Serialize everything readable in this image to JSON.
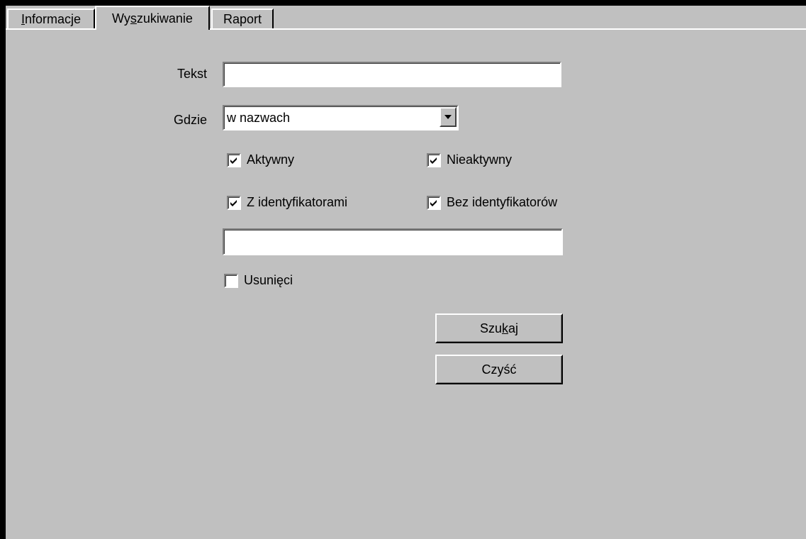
{
  "tabs": [
    {
      "label_pre": "",
      "label_u": "I",
      "label_post": "nformacje",
      "active": false
    },
    {
      "label_pre": "Wy",
      "label_u": "s",
      "label_post": "zukiwanie",
      "active": true
    },
    {
      "label_pre": "Raport",
      "label_u": "",
      "label_post": "",
      "active": false
    }
  ],
  "form": {
    "text_label": "Tekst",
    "text_value": "",
    "where_label": "Gdzie",
    "where_selected": "w nazwach",
    "active_label": "Aktywny",
    "active_checked": true,
    "inactive_label": "Nieaktywny",
    "inactive_checked": true,
    "with_ids_label": "Z identyfikatorami",
    "with_ids_checked": true,
    "without_ids_label": "Bez identyfikatorów",
    "without_ids_checked": true,
    "second_field_value": "",
    "deleted_label": "Usunięci",
    "deleted_checked": false
  },
  "buttons": {
    "search_pre": "Szu",
    "search_u": "k",
    "search_post": "aj",
    "clear_label": "Czyść"
  },
  "icons": {
    "combo_arrow": "triangle-down-icon",
    "check": "checkmark-icon"
  }
}
